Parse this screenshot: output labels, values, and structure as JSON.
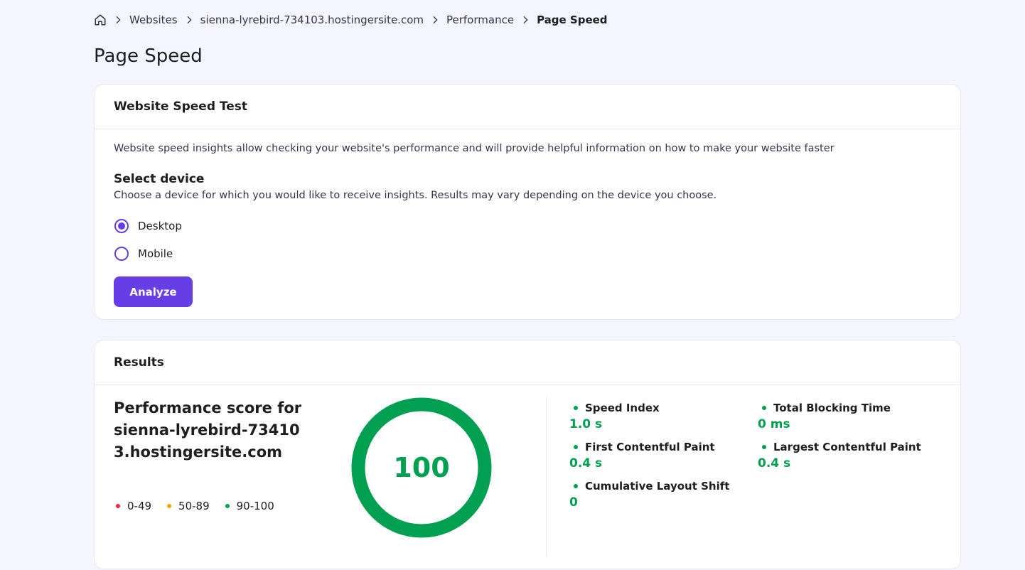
{
  "breadcrumb": {
    "items": [
      "Websites",
      "sienna-lyrebird-734103.hostingersite.com",
      "Performance"
    ],
    "current": "Page Speed"
  },
  "page": {
    "title": "Page Speed"
  },
  "speed_test": {
    "title": "Website Speed Test",
    "intro": "Website speed insights allow checking your website's performance and will provide helpful information on how to make your website faster",
    "device_heading": "Select device",
    "device_help": "Choose a device for which you would like to receive insights. Results may vary depending on the device you choose.",
    "options": [
      {
        "label": "Desktop",
        "selected": true
      },
      {
        "label": "Mobile",
        "selected": false
      }
    ],
    "analyze_label": "Analyze"
  },
  "results": {
    "title": "Results",
    "score_title": "Performance score for sienna-lyrebird-734103.hostingersite.com",
    "score": "100",
    "score_fraction": 1.0,
    "legend": [
      {
        "label": "0-49",
        "color": "#e5293c"
      },
      {
        "label": "50-89",
        "color": "#f5a300"
      },
      {
        "label": "90-100",
        "color": "#00a050"
      }
    ],
    "metrics": [
      {
        "label": "Speed Index",
        "value": "1.0 s"
      },
      {
        "label": "Total Blocking Time",
        "value": "0 ms"
      },
      {
        "label": "First Contentful Paint",
        "value": "0.4 s"
      },
      {
        "label": "Largest Contentful Paint",
        "value": "0.4 s"
      },
      {
        "label": "Cumulative Layout Shift",
        "value": "0"
      }
    ]
  },
  "colors": {
    "accent": "#673de6",
    "good": "#00a050",
    "background": "#f4f5ff"
  }
}
